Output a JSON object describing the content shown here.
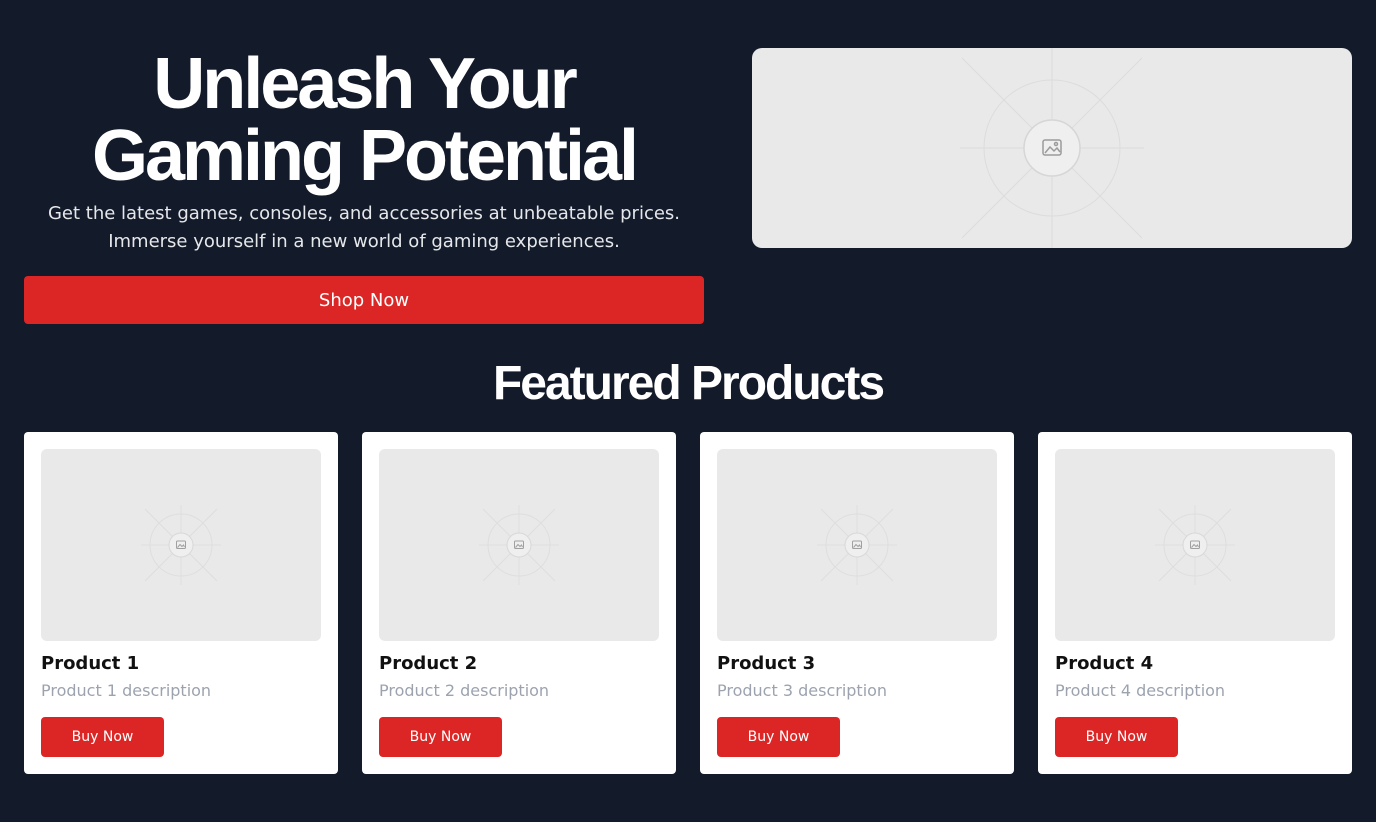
{
  "colors": {
    "background": "#131a29",
    "accent": "#dc2626",
    "card": "#ffffff",
    "placeholder": "#e9e9e9"
  },
  "hero": {
    "title_line1": "Unleash Your",
    "title_line2": "Gaming Potential",
    "subtitle_line1": "Get the latest games, consoles, and accessories at unbeatable prices.",
    "subtitle_line2": "Immerse yourself in a new world of gaming experiences.",
    "cta_label": "Shop Now",
    "image_icon": "image-placeholder-icon"
  },
  "featured": {
    "title": "Featured Products",
    "products": [
      {
        "name": "Product 1",
        "description": "Product 1 description",
        "button": "Buy Now",
        "image_icon": "image-placeholder-icon"
      },
      {
        "name": "Product 2",
        "description": "Product 2 description",
        "button": "Buy Now",
        "image_icon": "image-placeholder-icon"
      },
      {
        "name": "Product 3",
        "description": "Product 3 description",
        "button": "Buy Now",
        "image_icon": "image-placeholder-icon"
      },
      {
        "name": "Product 4",
        "description": "Product 4 description",
        "button": "Buy Now",
        "image_icon": "image-placeholder-icon"
      }
    ]
  }
}
